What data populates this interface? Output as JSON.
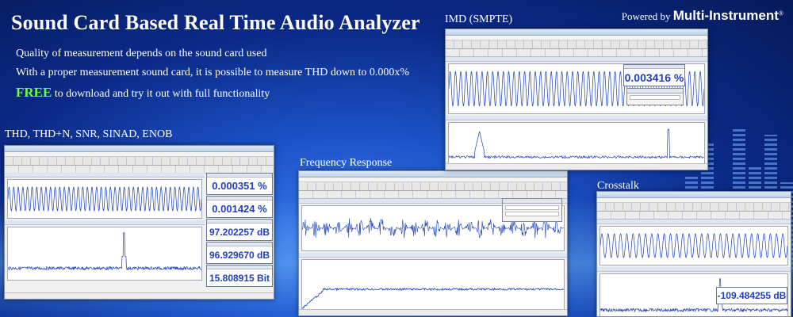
{
  "banner": {
    "headline": "Sound Card Based Real Time Audio Analyzer",
    "line1": "Quality of measurement depends on the sound card used",
    "line2": "With a proper measurement sound card, it is possible to measure THD down to 0.000x%",
    "free_word": "FREE",
    "line3_rest": " to download and try it out with full functionality",
    "powered_by": "Powered by",
    "brand": "Multi-Instrument",
    "brand_mark": "®"
  },
  "screenshots": {
    "thd": {
      "label": "THD, THD+N, SNR, SINAD, ENOB",
      "readings": [
        "0.000351 %",
        "0.001424 %",
        "97.202257 dB",
        "96.929670 dB",
        "15.808915 Bit"
      ]
    },
    "freq_response": {
      "label": "Frequency Response"
    },
    "imd": {
      "label": "IMD (SMPTE)",
      "reading": "0.003416 %"
    },
    "crosstalk": {
      "label": "Crosstalk",
      "reading": "-109.484255 dB"
    }
  },
  "colors": {
    "background": "#0b2a88",
    "headline": "#ffffff",
    "free": "#6cff3a",
    "reading_text": "#1f3fbf",
    "trace": "#1a3fb8"
  },
  "icons": [
    "window-titlebar",
    "toolbar-buttons",
    "signal-generator-panel"
  ]
}
